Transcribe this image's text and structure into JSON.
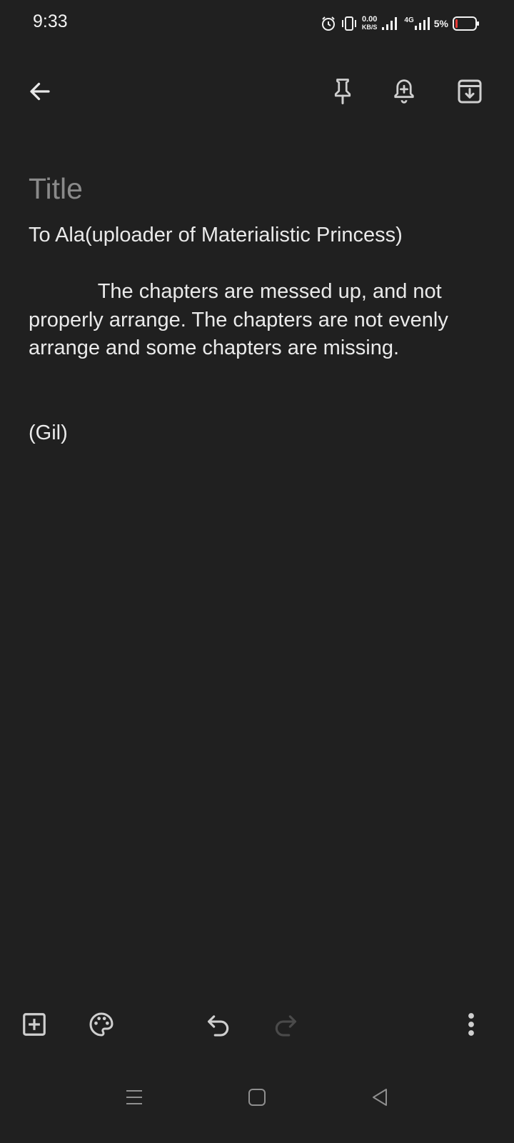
{
  "status_bar": {
    "time": "9:33",
    "net_speed_value": "0.00",
    "net_speed_unit": "KB/S",
    "network_type": "4G",
    "battery_percent": "5%",
    "icons": [
      "alarm-icon",
      "vibrate-icon",
      "signal-icon",
      "signal-4g-icon",
      "battery-icon"
    ]
  },
  "toolbar": {
    "icons": [
      "back-arrow-icon",
      "pin-icon",
      "reminder-bell-icon",
      "archive-icon"
    ]
  },
  "note": {
    "title_placeholder": "Title",
    "title_value": "",
    "body": "To Ala(uploader of Materialistic Princess)\n\n            The chapters are messed up, and not properly arrange. The chapters are not evenly arrange and some chapters are missing.\n\n\n(Gil)"
  },
  "bottom_bar": {
    "icons": [
      "add-box-icon",
      "palette-icon",
      "undo-icon",
      "redo-icon",
      "more-vert-icon"
    ]
  },
  "nav_bar": {
    "icons": [
      "recents-menu-icon",
      "home-square-icon",
      "back-triangle-icon"
    ]
  },
  "colors": {
    "background": "#202020",
    "text": "#eaeaea",
    "placeholder": "#8a8a8a",
    "icon": "#cfcfcf",
    "disabled_icon": "#4a4a4a",
    "battery_low": "#e53935"
  }
}
